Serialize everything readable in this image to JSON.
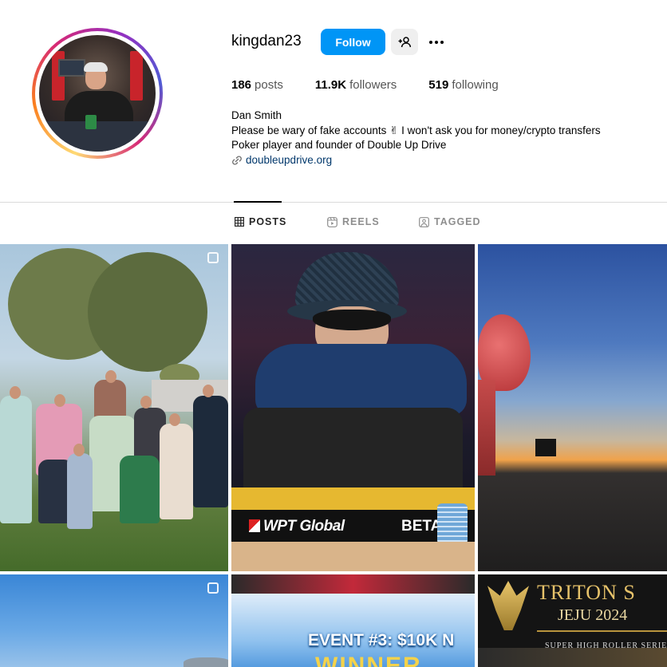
{
  "profile": {
    "username": "kingdan23",
    "follow_label": "Follow",
    "stats": {
      "posts_count": "186",
      "posts_label": "posts",
      "followers_count": "11.9K",
      "followers_label": "followers",
      "following_count": "519",
      "following_label": "following"
    },
    "bio": {
      "name": "Dan Smith",
      "line1": "Please be wary of fake accounts ✌ I won't ask you for money/crypto transfers",
      "line2": "Poker player and founder of Double Up Drive",
      "link": "doubleupdrive.org"
    }
  },
  "tabs": [
    {
      "label": "POSTS",
      "icon": "grid-icon",
      "active": true
    },
    {
      "label": "REELS",
      "icon": "reels-icon",
      "active": false
    },
    {
      "label": "TAGGED",
      "icon": "tagged-icon",
      "active": false
    }
  ],
  "posts": {
    "p2": {
      "brand": "WPT Global",
      "brand2": "BETA"
    },
    "p5": {
      "text": "EVENT #3: $10K N",
      "text2": "WINNER"
    },
    "p6": {
      "title": "TRITON S",
      "subtitle": "JEJU 2024",
      "series": "SUPER HIGH ROLLER SERIE"
    }
  },
  "colors": {
    "accent": "#0095f6",
    "link": "#00376b",
    "muted": "#8e8e8e"
  }
}
